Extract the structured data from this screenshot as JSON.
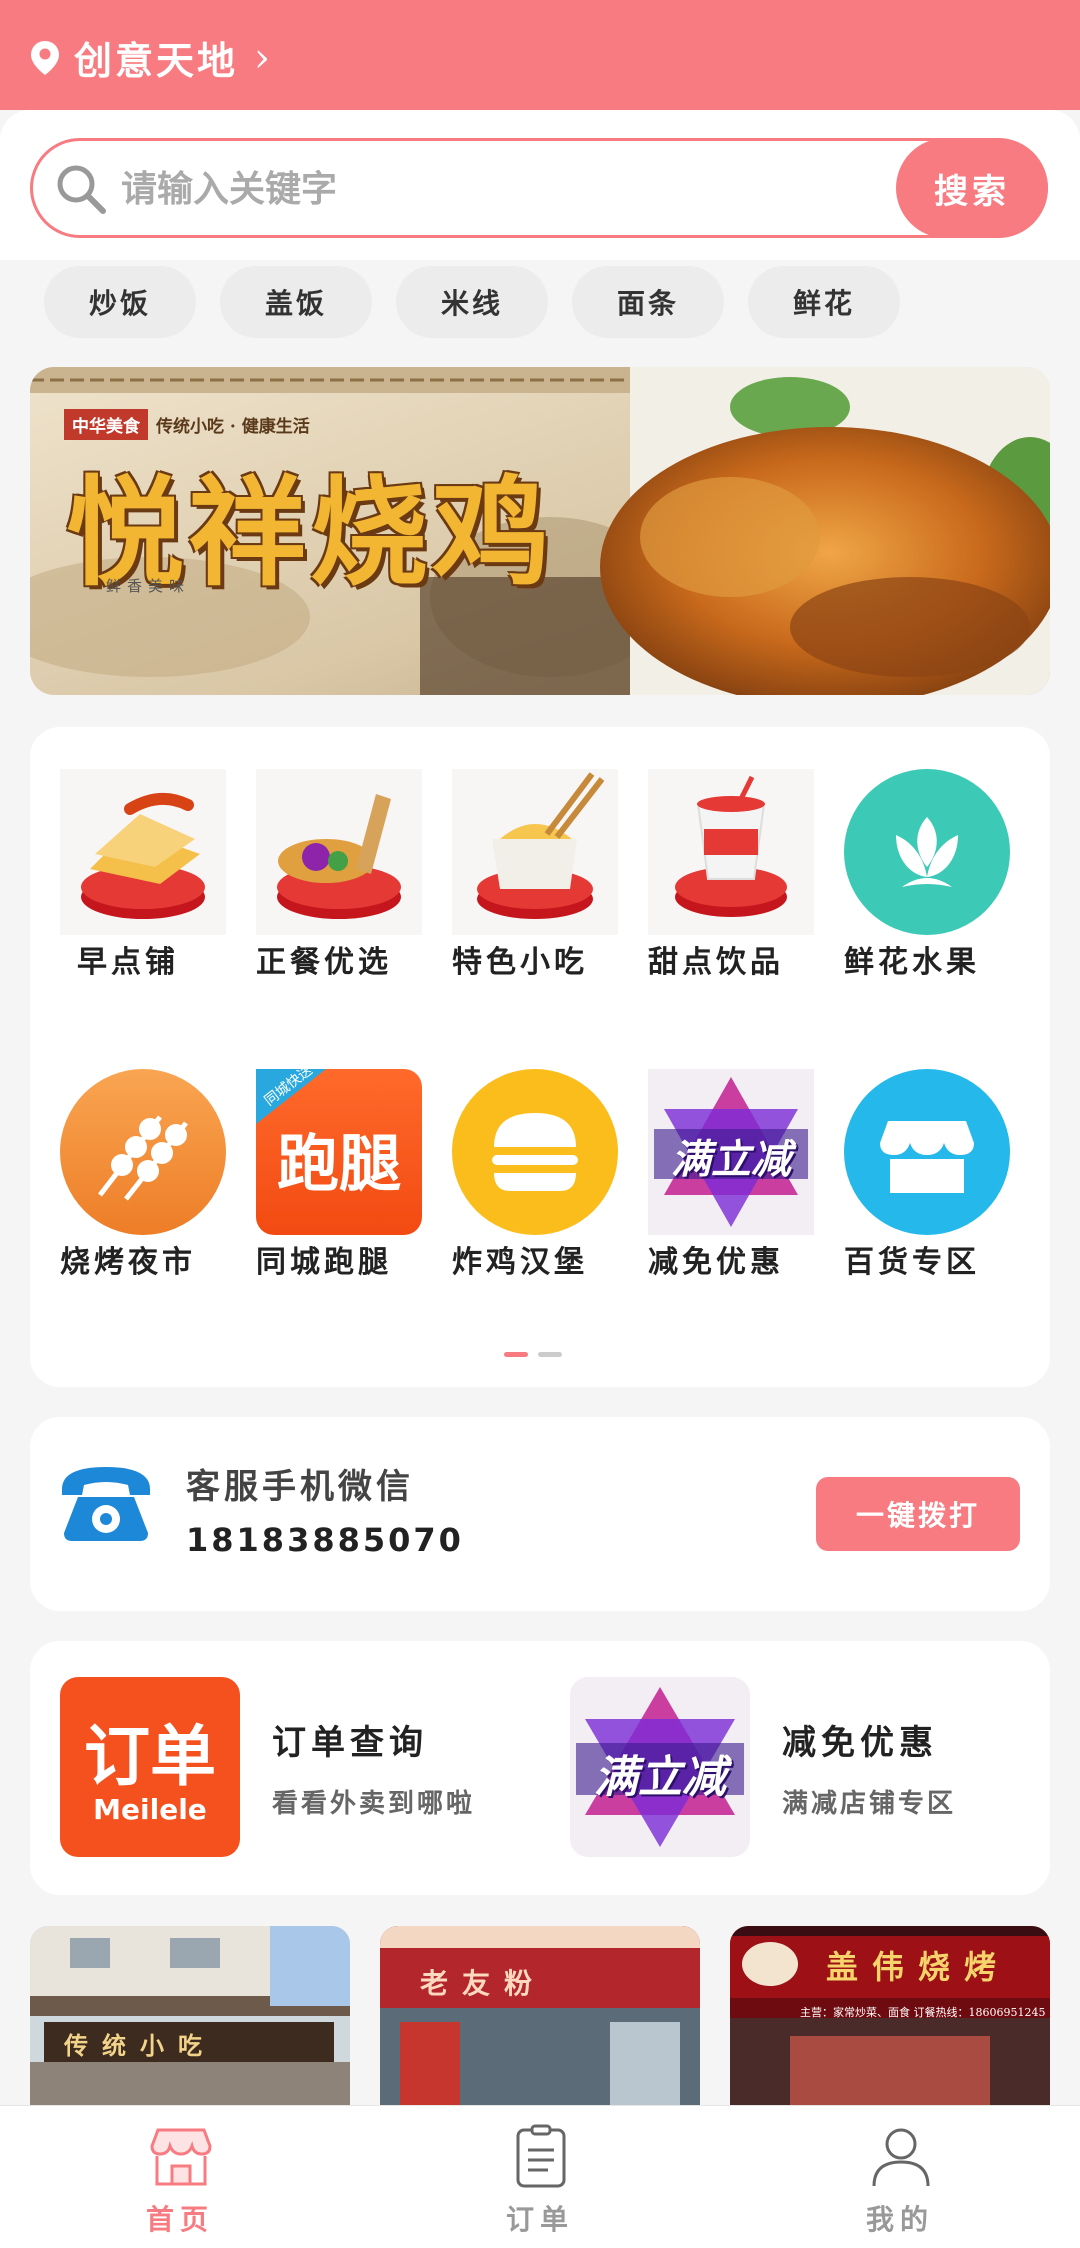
{
  "header": {
    "location": "创意天地",
    "arrow": "›"
  },
  "search": {
    "placeholder": "请输入关键字",
    "button": "搜索"
  },
  "tags": [
    "炒饭",
    "盖饭",
    "米线",
    "面条",
    "鲜花"
  ],
  "banner": {
    "badge": "中华美食",
    "subtitle": "传统小吃 · 健康生活",
    "title": "悦祥烧鸡",
    "caption": "鲜香美味"
  },
  "categories": [
    {
      "label": "早点铺",
      "icon": "breakfast-icon"
    },
    {
      "label": "正餐优选",
      "icon": "main-meal-icon"
    },
    {
      "label": "特色小吃",
      "icon": "snack-icon"
    },
    {
      "label": "甜点饮品",
      "icon": "drink-icon"
    },
    {
      "label": "鲜花水果",
      "icon": "flower-icon"
    },
    {
      "label": "烧烤夜市",
      "icon": "bbq-icon"
    },
    {
      "label": "同城跑腿",
      "icon": "errand-icon",
      "icon_text": "跑腿",
      "icon_corner": "同城快送"
    },
    {
      "label": "炸鸡汉堡",
      "icon": "burger-icon"
    },
    {
      "label": "减免优惠",
      "icon": "discount-icon",
      "icon_text": "满立减"
    },
    {
      "label": "百货专区",
      "icon": "store-icon"
    }
  ],
  "pagination": {
    "active": 0,
    "total": 2
  },
  "service": {
    "title": "客服手机微信",
    "phone": "18183885070",
    "button": "一键拨打"
  },
  "quick": [
    {
      "title": "订单查询",
      "subtitle": "看看外卖到哪啦",
      "image_text": "订单",
      "image_brand": "Meilele"
    },
    {
      "title": "减免优惠",
      "subtitle": "满减店铺专区",
      "image_text": "满立减"
    }
  ],
  "shops": [
    {
      "sign": "传统小吃"
    },
    {
      "sign": "老友粉"
    },
    {
      "sign": "盖伟烧烤",
      "sub": "主营：家常炒菜、面食   订餐热线：18606951245"
    }
  ],
  "tabbar": [
    {
      "label": "首页",
      "icon": "store-icon",
      "active": true
    },
    {
      "label": "订单",
      "icon": "order-icon",
      "active": false
    },
    {
      "label": "我的",
      "icon": "user-icon",
      "active": false
    }
  ],
  "colors": {
    "accent": "#f77b80",
    "background": "#f5f5f5"
  }
}
